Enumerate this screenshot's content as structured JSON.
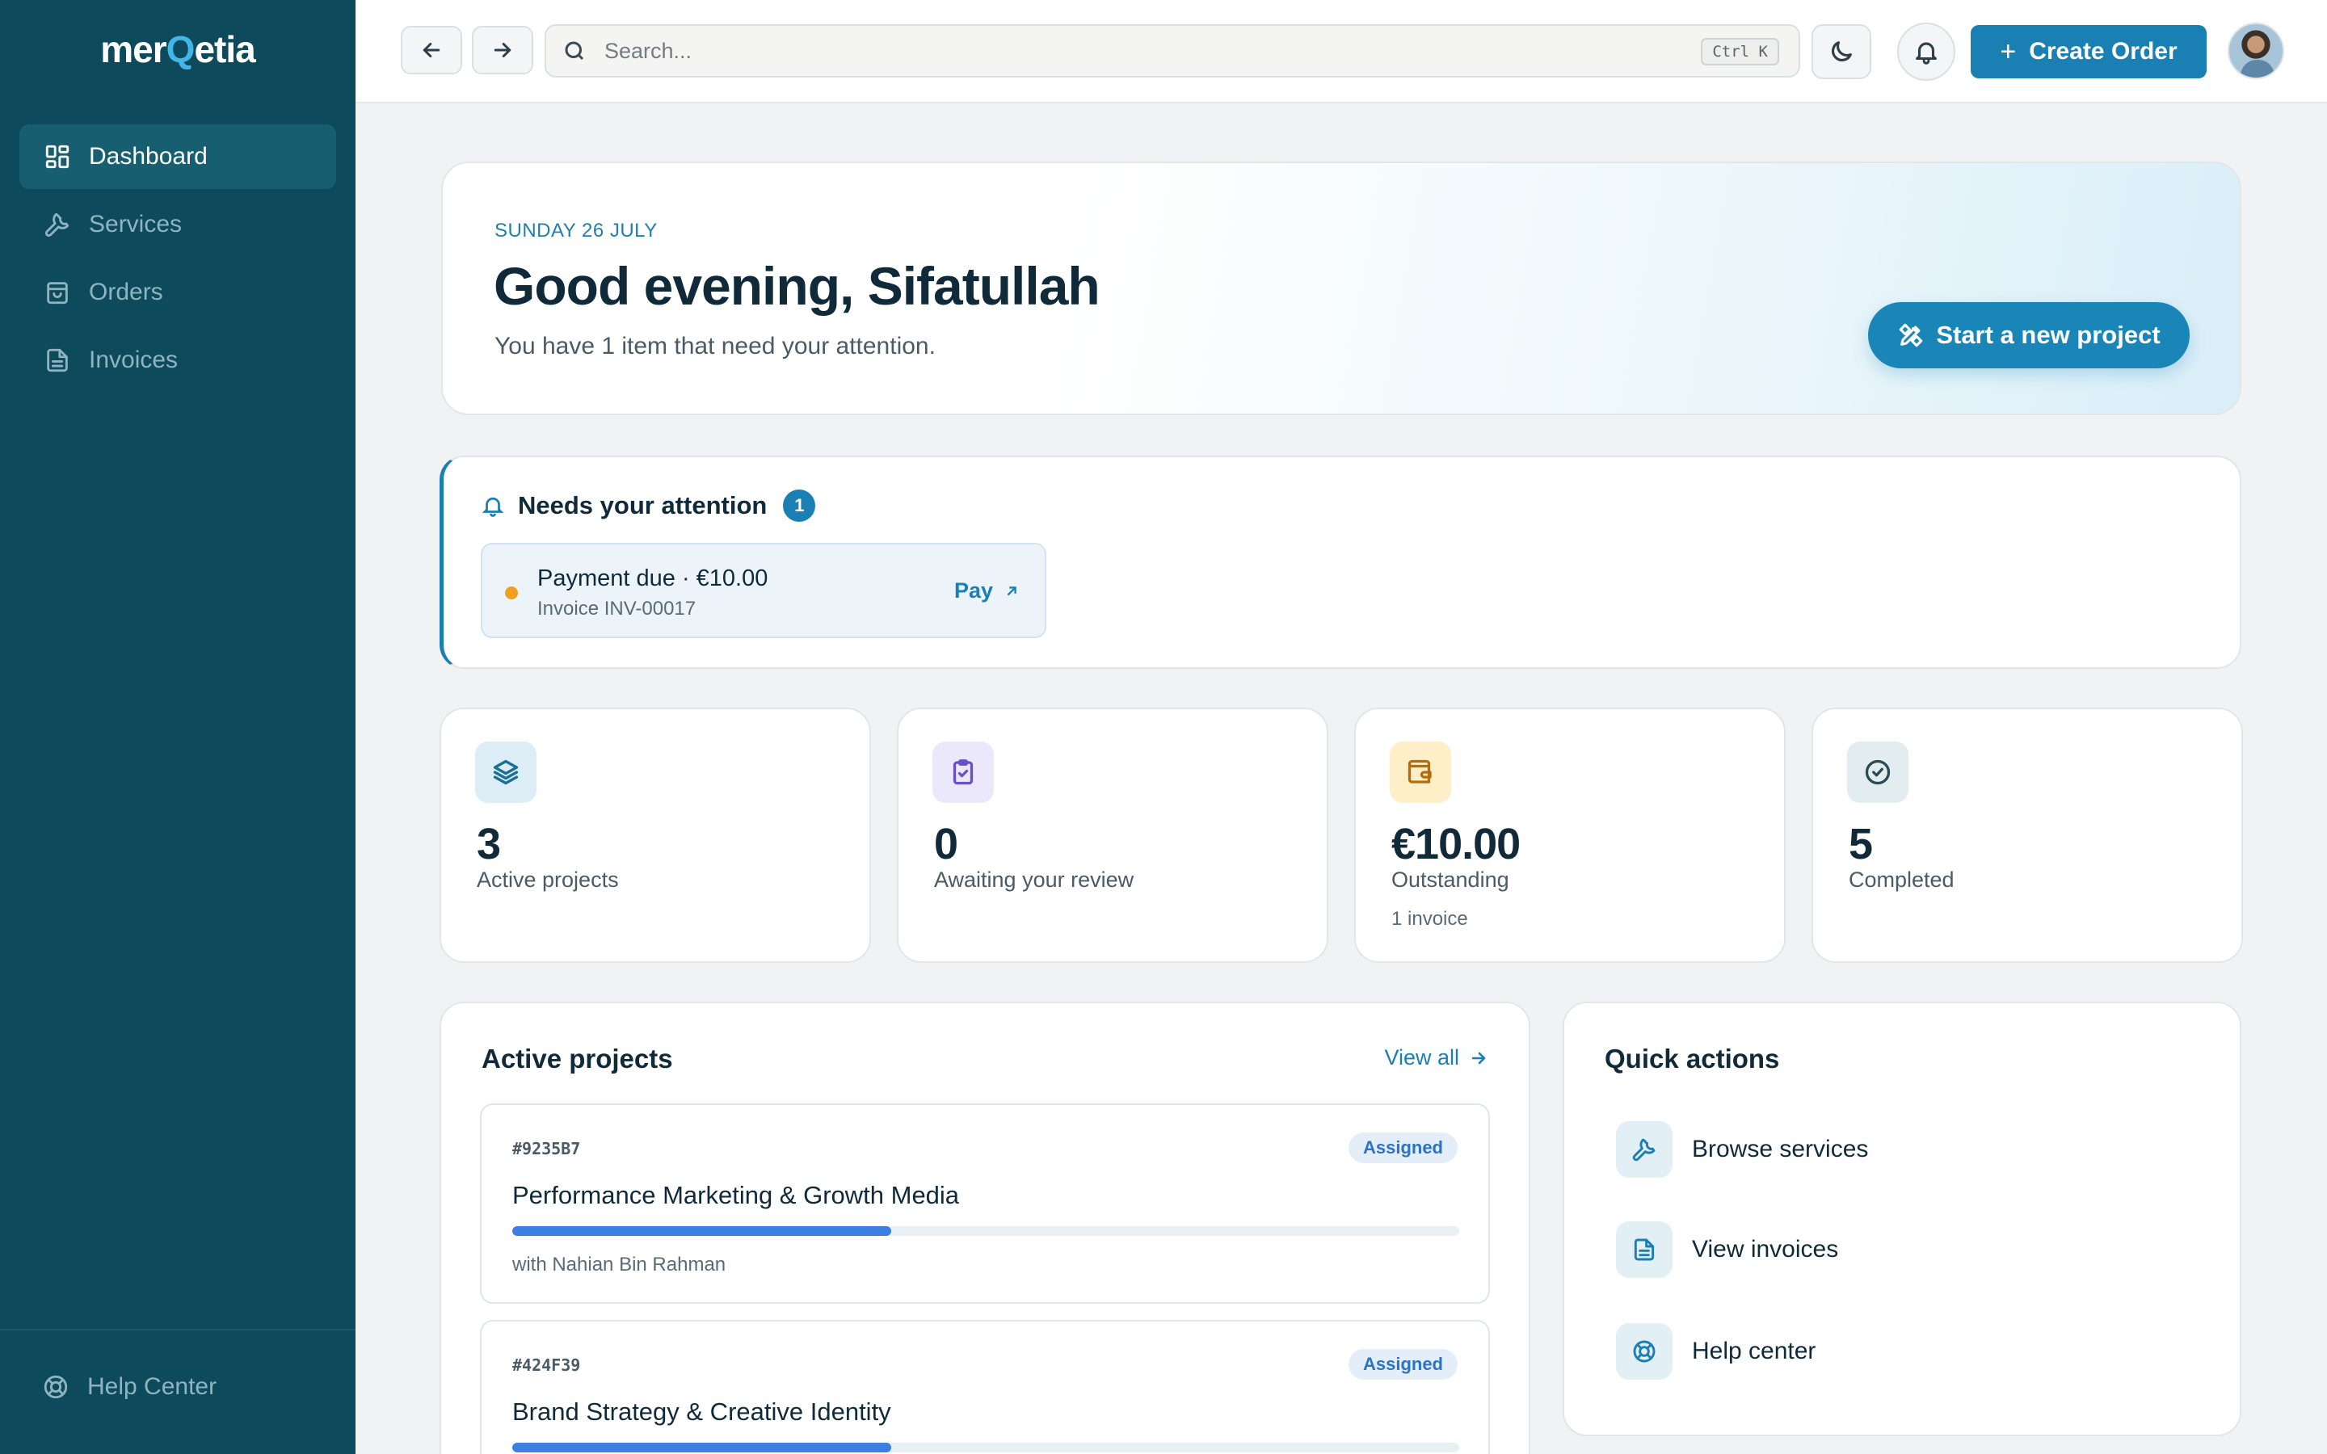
{
  "app": {
    "logo_left": "mer",
    "logo_mark": "Q",
    "logo_right": "etia"
  },
  "sidebar": {
    "items": [
      {
        "label": "Dashboard",
        "icon": "dashboard-grid-icon",
        "active": true
      },
      {
        "label": "Services",
        "icon": "wrench-icon",
        "active": false
      },
      {
        "label": "Orders",
        "icon": "shopping-bag-icon",
        "active": false
      },
      {
        "label": "Invoices",
        "icon": "document-icon",
        "active": false
      }
    ],
    "help_label": "Help Center"
  },
  "topbar": {
    "search_placeholder": "Search...",
    "shortcut": "Ctrl K",
    "create_label": "Create Order"
  },
  "hero": {
    "date": "SUNDAY 26 JULY",
    "greeting": "Good evening, Sifatullah",
    "subtitle": "You have 1 item that need your attention.",
    "cta": "Start a new project"
  },
  "attention": {
    "title": "Needs your attention",
    "count": "1",
    "item_title": "Payment due · €10.00",
    "item_sub": "Invoice INV-00017",
    "item_action": "Pay"
  },
  "stats": [
    {
      "value": "3",
      "label": "Active projects",
      "note": "",
      "icon": "layers-icon",
      "icon_bg": "#dcedf6",
      "icon_color": "#1a6f95"
    },
    {
      "value": "0",
      "label": "Awaiting your review",
      "note": "",
      "icon": "clipboard-check-icon",
      "icon_bg": "#ece8fb",
      "icon_color": "#6a4fc8"
    },
    {
      "value": "€10.00",
      "label": "Outstanding",
      "note": "1 invoice",
      "icon": "wallet-icon",
      "icon_bg": "#fdefc8",
      "icon_color": "#b86b0c"
    },
    {
      "value": "5",
      "label": "Completed",
      "note": "",
      "icon": "check-circle-icon",
      "icon_bg": "#e3ecef",
      "icon_color": "#2b4a58"
    }
  ],
  "projects": {
    "title": "Active projects",
    "view_all": "View all",
    "items": [
      {
        "id": "#9235B7",
        "status": "Assigned",
        "name": "Performance Marketing & Growth Media",
        "progress": 0.4,
        "with": "with Nahian Bin Rahman"
      },
      {
        "id": "#424F39",
        "status": "Assigned",
        "name": "Brand Strategy & Creative Identity",
        "progress": 0.4,
        "with": ""
      }
    ]
  },
  "quick_actions": {
    "title": "Quick actions",
    "items": [
      {
        "label": "Browse services",
        "icon": "wrench-icon"
      },
      {
        "label": "View invoices",
        "icon": "document-icon"
      },
      {
        "label": "Help center",
        "icon": "lifebuoy-icon"
      }
    ]
  }
}
